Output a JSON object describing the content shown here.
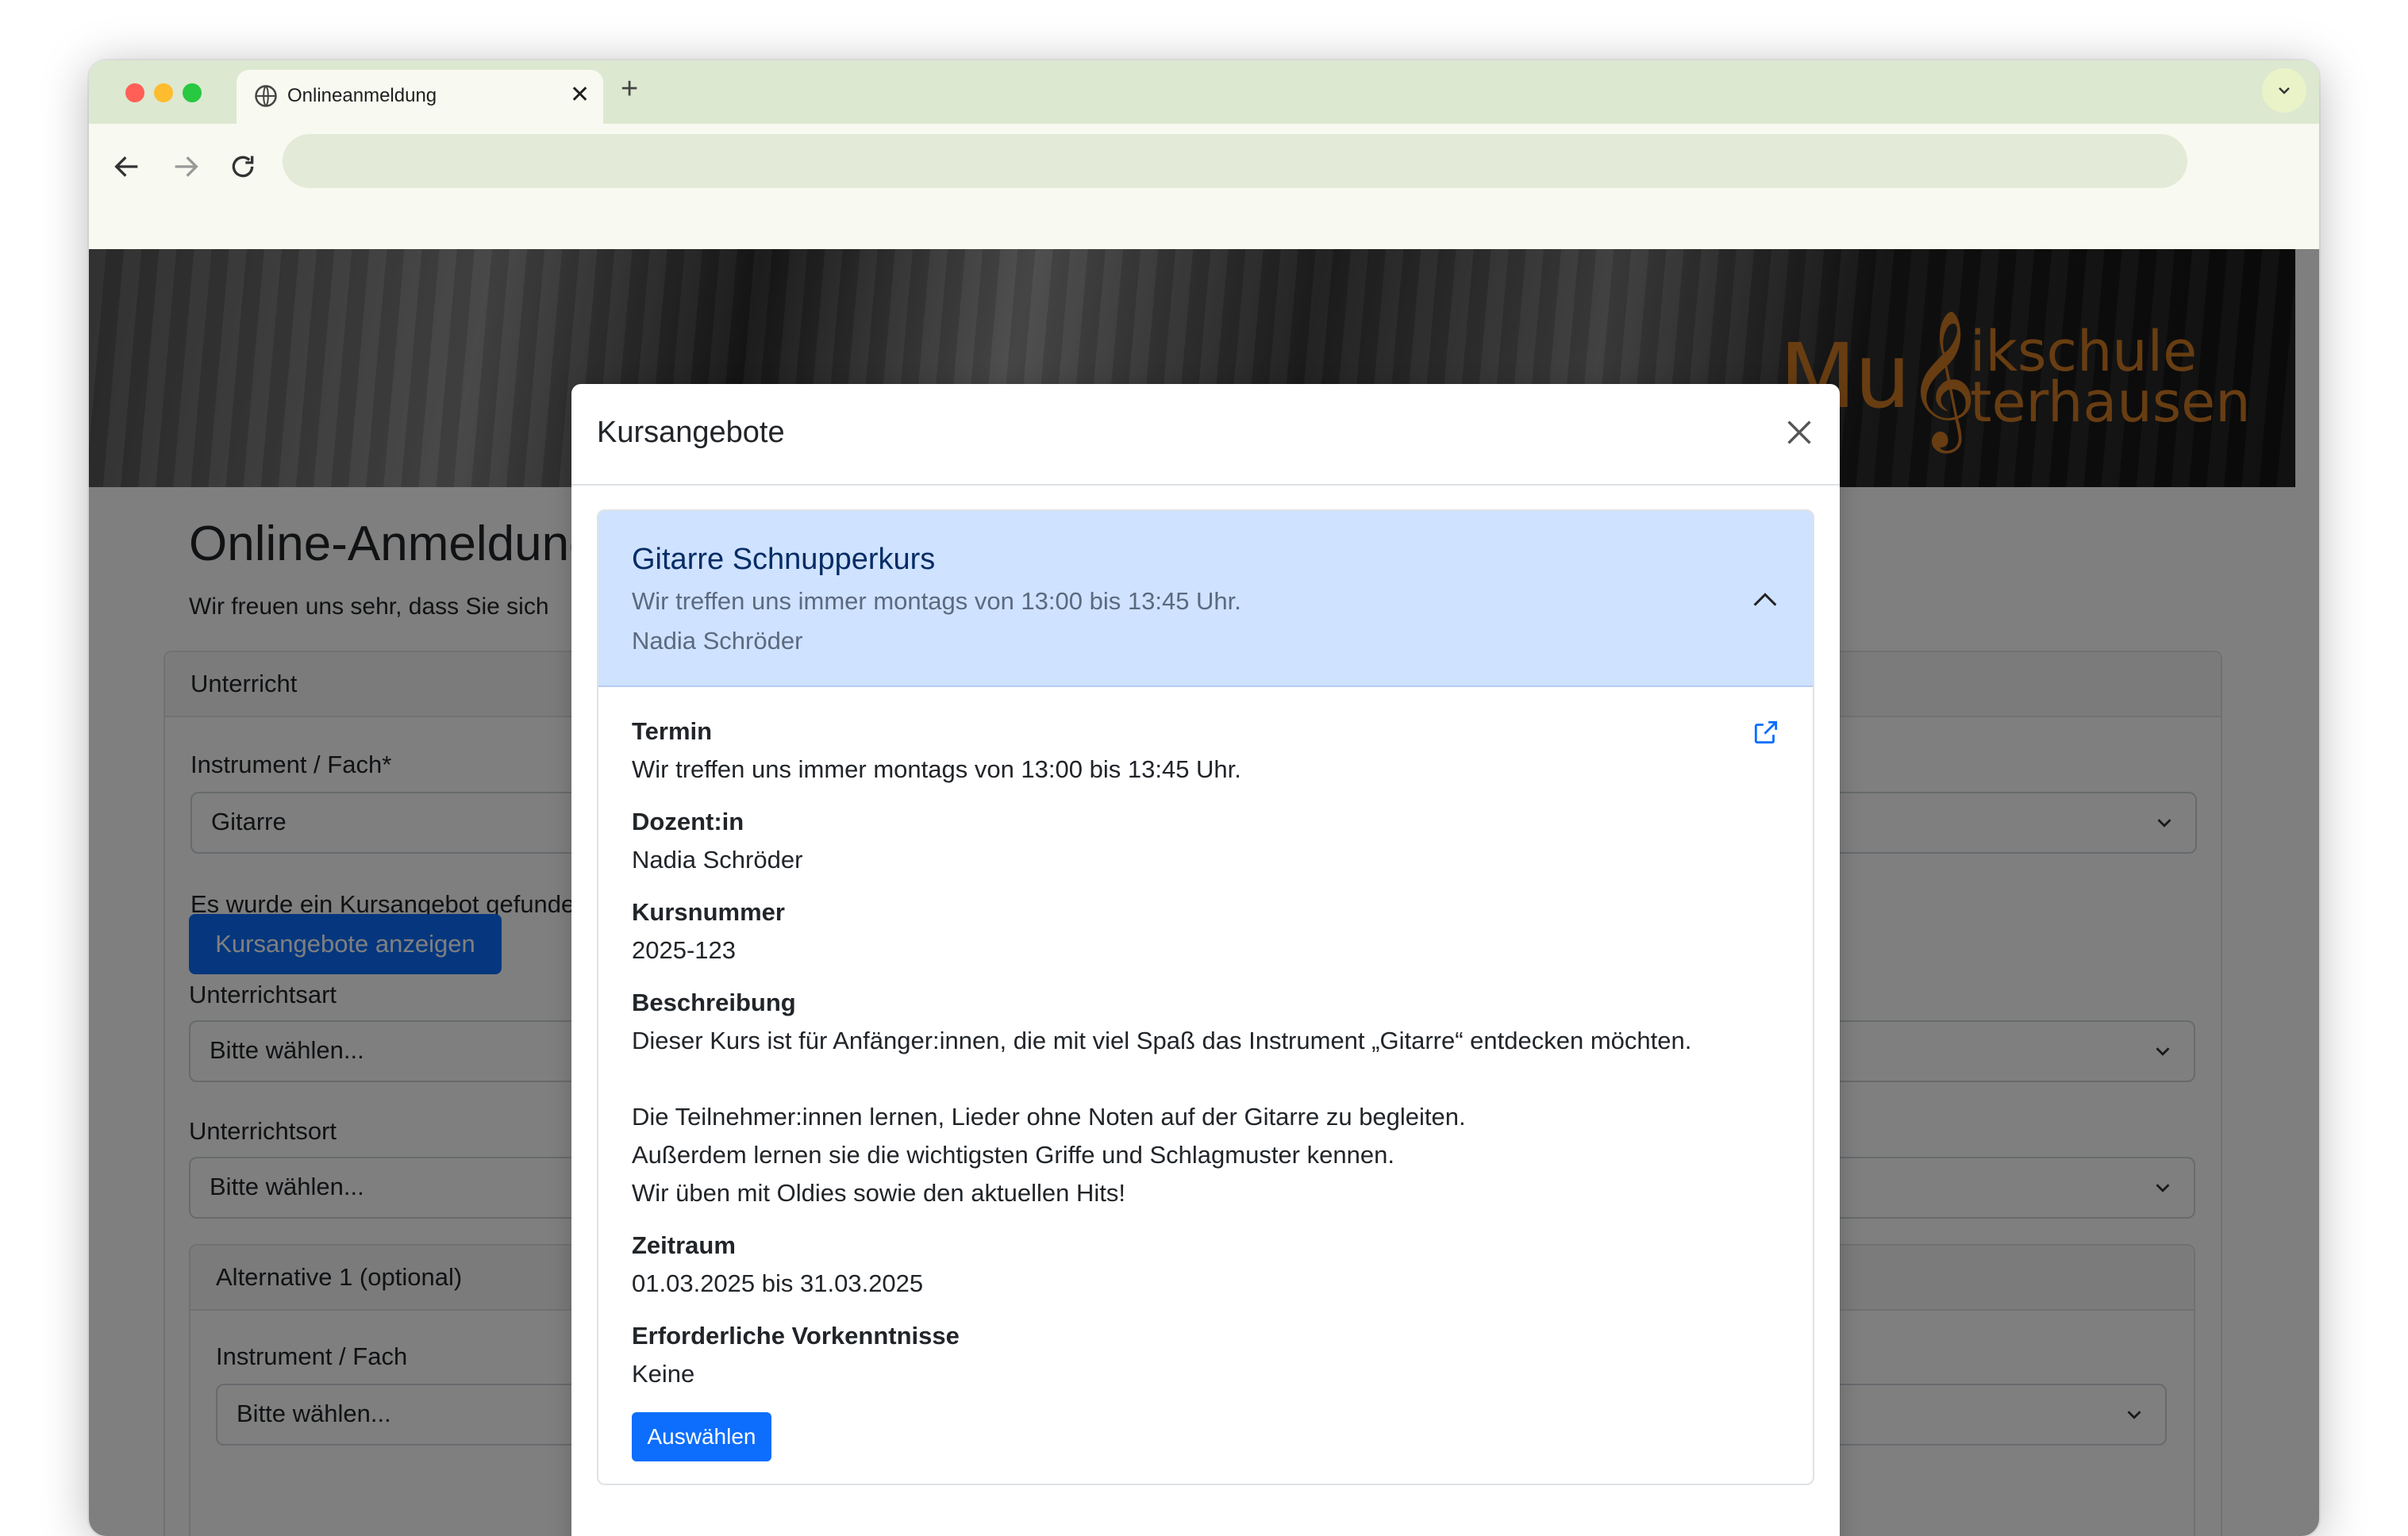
{
  "browser": {
    "tab_title": "Onlineanmeldung",
    "tab_close": "✕",
    "new_tab": "+"
  },
  "logo": {
    "part1": "Mu",
    "clef": "𝄞",
    "line1": "ikschule",
    "line2": "terhausen"
  },
  "page": {
    "title": "Online-Anmeldung",
    "lead": "Wir freuen uns sehr, dass Sie sich",
    "card_header": "Unterricht",
    "instrument_label": "Instrument / Fach*",
    "instrument_value": "Gitarre",
    "found_text": "Es wurde ein Kursangebot gefunden",
    "show_offers_button": "Kursangebote anzeigen",
    "type_label": "Unterrichtsart",
    "type_value": "Bitte wählen...",
    "location_label": "Unterrichtsort",
    "location_value": "Bitte wählen...",
    "alt_header": "Alternative 1 (optional)",
    "alt_instrument_label": "Instrument / Fach",
    "alt_instrument_value": "Bitte wählen..."
  },
  "modal": {
    "title": "Kursangebote",
    "course": {
      "name": "Gitarre Schnupperkurs",
      "schedule": "Wir treffen uns immer montags von 13:00 bis 13:45 Uhr.",
      "teacher": "Nadia Schröder"
    },
    "details": {
      "termin_label": "Termin",
      "termin_value": "Wir treffen uns immer montags von 13:00 bis 13:45 Uhr.",
      "dozent_label": "Dozent:in",
      "dozent_value": "Nadia Schröder",
      "kursnummer_label": "Kursnummer",
      "kursnummer_value": "2025-123",
      "beschreibung_label": "Beschreibung",
      "beschreibung_lines": [
        "Dieser Kurs ist für Anfänger:innen, die mit viel Spaß das Instrument „Gitarre“ entdecken möchten.",
        "Die Teilnehmer:innen lernen, Lieder ohne Noten auf der Gitarre zu begleiten.",
        "Außerdem lernen sie die wichtigsten Griffe und Schlagmuster kennen.",
        "Wir üben mit Oldies sowie den aktuellen Hits!"
      ],
      "zeitraum_label": "Zeitraum",
      "zeitraum_value": "01.03.2025 bis 31.03.2025",
      "vorkenntnisse_label": "Erforderliche Vorkenntnisse",
      "vorkenntnisse_value": "Keine"
    },
    "select_button": "Auswählen"
  },
  "icons": {
    "tab": "globe-icon",
    "nav": [
      "back-arrow-icon",
      "forward-arrow-icon",
      "reload-icon"
    ],
    "modal": [
      "close-icon",
      "chevron-up-icon",
      "external-link-icon"
    ],
    "select": "chevron-down-icon"
  },
  "colors": {
    "primary": "#0d6efd",
    "accordion_header": "#cfe2ff",
    "logo": "#d07a25",
    "tabstrip": "#dce8d0"
  }
}
